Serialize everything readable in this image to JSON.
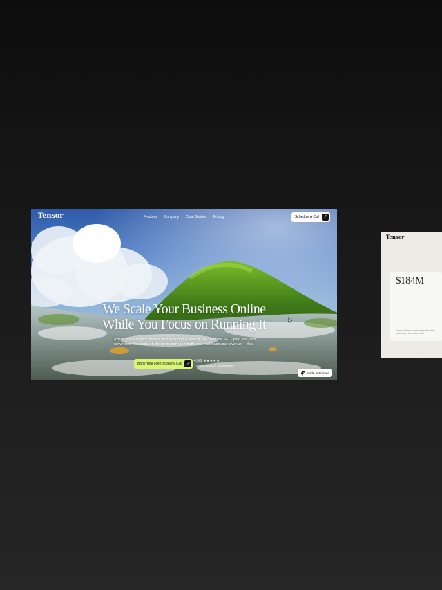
{
  "hero": {
    "brand": "Tensor",
    "nav": [
      "Features",
      "Company",
      "Case Studies",
      "Pricing"
    ],
    "cta": "Schedule A Call",
    "headline": [
      "We Scale Your Business Online",
      "While You Focus on Running It"
    ],
    "subheadline": "Growth marketing for owners who are done guessing. We combine SEO, paid ads, and conversion-focused web design to turn your traffic into real leads and revenue — fast.",
    "primary_cta": "Book Your Free Strategy Call",
    "rating": {
      "score": "4.9/5",
      "stars": "★★★★★",
      "trusted": "Trusted by 200+ Businesses"
    },
    "badge": "Made in Framer"
  },
  "preview": {
    "brand": "Tensor",
    "stat": "$184M",
    "caption": "Generated in tracked revenue for the businesses we partner with"
  },
  "icons": {
    "arrow": "arrow-up-right-icon",
    "framer": "framer-logo-icon",
    "cursor": "mouse-cursor-icon"
  },
  "colors": {
    "accent": "#d9f777",
    "background": "#1a1a1a",
    "sky": "#4d7cc4",
    "hill": "#4f8a1c"
  }
}
